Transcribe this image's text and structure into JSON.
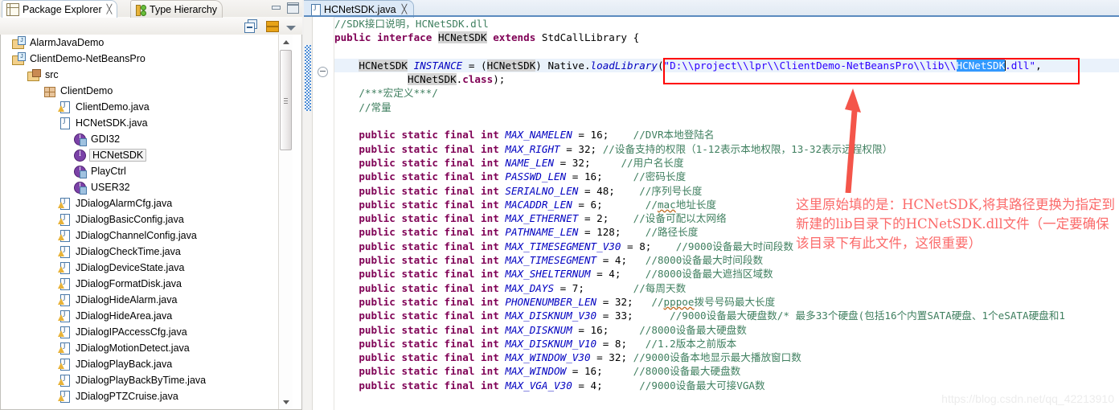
{
  "left_panel": {
    "tabs": [
      {
        "label": "Package Explorer",
        "icon": "package-explorer-icon",
        "active": true,
        "close": "╳"
      },
      {
        "label": "Type Hierarchy",
        "icon": "type-hierarchy-icon",
        "active": false,
        "close": ""
      }
    ],
    "window_buttons": {
      "minimize": "minimize-icon",
      "maximize": "maximize-icon"
    },
    "toolbar": [
      {
        "name": "collapse-all-button",
        "tooltip": "Collapse All"
      },
      {
        "name": "link-with-editor-button",
        "tooltip": "Link with Editor"
      },
      {
        "name": "view-menu-button",
        "tooltip": "View Menu"
      }
    ],
    "tree": [
      {
        "label": "AlarmJavaDemo",
        "indent": 0,
        "icon": "java-project-icon",
        "selected": false
      },
      {
        "label": "ClientDemo-NetBeansPro",
        "indent": 0,
        "icon": "java-project-icon",
        "selected": false
      },
      {
        "label": "src",
        "indent": 1,
        "icon": "source-folder-icon",
        "selected": false
      },
      {
        "label": "ClientDemo",
        "indent": 2,
        "icon": "package-icon",
        "selected": false
      },
      {
        "label": "ClientDemo.java",
        "indent": 3,
        "icon": "java-file-warning-icon",
        "selected": false
      },
      {
        "label": "HCNetSDK.java",
        "indent": 3,
        "icon": "java-file-icon",
        "selected": false
      },
      {
        "label": "GDI32",
        "indent": 4,
        "icon": "interface-private-icon",
        "selected": false
      },
      {
        "label": "HCNetSDK",
        "indent": 4,
        "icon": "interface-icon",
        "selected": true
      },
      {
        "label": "PlayCtrl",
        "indent": 4,
        "icon": "interface-private-icon",
        "selected": false
      },
      {
        "label": "USER32",
        "indent": 4,
        "icon": "interface-private-icon",
        "selected": false
      },
      {
        "label": "JDialogAlarmCfg.java",
        "indent": 3,
        "icon": "java-file-warning-icon",
        "selected": false
      },
      {
        "label": "JDialogBasicConfig.java",
        "indent": 3,
        "icon": "java-file-warning-icon",
        "selected": false
      },
      {
        "label": "JDialogChannelConfig.java",
        "indent": 3,
        "icon": "java-file-warning-icon",
        "selected": false
      },
      {
        "label": "JDialogCheckTime.java",
        "indent": 3,
        "icon": "java-file-warning-icon",
        "selected": false
      },
      {
        "label": "JDialogDeviceState.java",
        "indent": 3,
        "icon": "java-file-warning-icon",
        "selected": false
      },
      {
        "label": "JDialogFormatDisk.java",
        "indent": 3,
        "icon": "java-file-warning-icon",
        "selected": false
      },
      {
        "label": "JDialogHideAlarm.java",
        "indent": 3,
        "icon": "java-file-warning-icon",
        "selected": false
      },
      {
        "label": "JDialogHideArea.java",
        "indent": 3,
        "icon": "java-file-warning-icon",
        "selected": false
      },
      {
        "label": "JDialogIPAccessCfg.java",
        "indent": 3,
        "icon": "java-file-warning-icon",
        "selected": false
      },
      {
        "label": "JDialogMotionDetect.java",
        "indent": 3,
        "icon": "java-file-warning-icon",
        "selected": false
      },
      {
        "label": "JDialogPlayBack.java",
        "indent": 3,
        "icon": "java-file-warning-icon",
        "selected": false
      },
      {
        "label": "JDialogPlayBackByTime.java",
        "indent": 3,
        "icon": "java-file-warning-icon",
        "selected": false
      },
      {
        "label": "JDialogPTZCruise.java",
        "indent": 3,
        "icon": "java-file-warning-icon",
        "selected": false
      }
    ]
  },
  "editor": {
    "tab": {
      "label": "HCNetSDK.java",
      "icon": "java-file-icon",
      "close": "╳"
    },
    "lines": [
      "//SDK接口说明，HCNetSDK.dll",
      "public interface HCNetSDK extends StdCallLibrary {",
      "",
      "    HCNetSDK INSTANCE = (HCNetSDK) Native.loadLibrary(\"D:\\\\project\\\\lpr\\\\ClientDemo-NetBeansPro\\\\lib\\\\HCNetSDK.dll\",",
      "            HCNetSDK.class);",
      "    /***宏定义***/",
      "    //常量",
      "",
      "    public static final int MAX_NAMELEN = 16;    //DVR本地登陆名",
      "    public static final int MAX_RIGHT = 32; //设备支持的权限（1-12表示本地权限，13-32表示远程权限）",
      "    public static final int NAME_LEN = 32;     //用户名长度",
      "    public static final int PASSWD_LEN = 16;     //密码长度",
      "    public static final int SERIALNO_LEN = 48;    //序列号长度",
      "    public static final int MACADDR_LEN = 6;       //mac地址长度",
      "    public static final int MAX_ETHERNET = 2;    //设备可配以太网络",
      "    public static final int PATHNAME_LEN = 128;    //路径长度",
      "    public static final int MAX_TIMESEGMENT_V30 = 8;    //9000设备最大时间段数",
      "    public static final int MAX_TIMESEGMENT = 4;   //8000设备最大时间段数",
      "    public static final int MAX_SHELTERNUM = 4;    //8000设备最大遮挡区域数",
      "    public static final int MAX_DAYS = 7;        //每周天数",
      "    public static final int PHONENUMBER_LEN = 32;   //pppoe拨号号码最大长度",
      "    public static final int MAX_DISKNUM_V30 = 33;      //9000设备最大硬盘数/* 最多33个硬盘(包括16个内置SATA硬盘、1个eSATA硬盘和1",
      "    public static final int MAX_DISKNUM = 16;     //8000设备最大硬盘数",
      "    public static final int MAX_DISKNUM_V10 = 8;   //1.2版本之前版本",
      "    public static final int MAX_WINDOW_V30 = 32; //9000设备本地显示最大播放窗口数",
      "    public static final int MAX_WINDOW = 16;     //8000设备最大硬盘数",
      "    public static final int MAX_VGA_V30 = 4;      //9000设备最大可接VGA数"
    ],
    "highlighted_occurrences": [
      "HCNetSDK"
    ],
    "selection": {
      "text": "HCNetSDK",
      "line": 3,
      "color": "#3399ff"
    },
    "fold_marker_line": 3
  },
  "annotations": {
    "red_box": {
      "target": "library-path-string",
      "color": "#ff0000"
    },
    "arrow": {
      "color": "#ff3b30",
      "from": "annotation-text",
      "to": "library-path-string"
    },
    "text": "这里原始填的是：HCNetSDK,将其路径更换为指定到新建的lib目录下的HCNetSDK.dll文件（一定要确保该目录下有此文件，这很重要）",
    "text_color": "#fb6a6a"
  },
  "watermark": {
    "text": "https://blog.csdn.net/qq_42213910",
    "color": "#ececec"
  }
}
